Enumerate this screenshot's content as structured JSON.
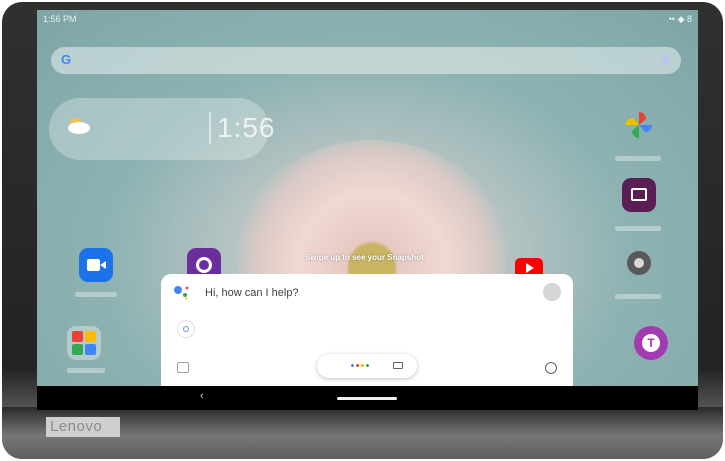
{
  "status_bar": {
    "time": "1:56 PM",
    "right": "•• ◆ 8"
  },
  "search": {
    "logo": "G"
  },
  "weather_widget": {
    "clock": "1:56"
  },
  "hint": {
    "text": "Swipe up to see your Snapshot"
  },
  "assistant": {
    "greeting": "Hi, how can I help?",
    "dot_colors": [
      "#4285f4",
      "#ea4335",
      "#fbbc05",
      "#34a853"
    ]
  },
  "device": {
    "brand": "Lenovo"
  },
  "colors": {
    "google_blue": "#4285f4",
    "google_red": "#ea4335",
    "google_yellow": "#fbbc05",
    "google_green": "#34a853"
  },
  "icons": [
    "search-icon",
    "mic-icon",
    "weather-icon",
    "photos-icon",
    "video-icon",
    "settings-icon",
    "youtube-icon",
    "back-icon",
    "keyboard-icon",
    "compass-icon"
  ]
}
